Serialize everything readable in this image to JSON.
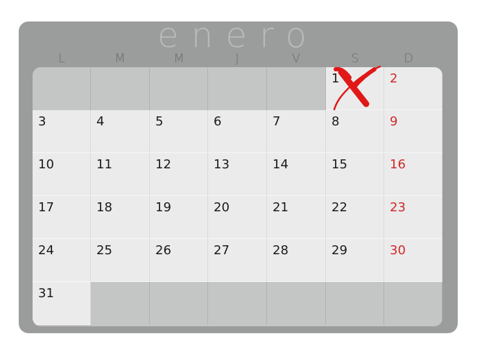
{
  "calendar": {
    "month": "enero",
    "weekdays": [
      "L",
      "M",
      "M",
      "J",
      "V",
      "S",
      "D"
    ],
    "leading_empty_cells": 5,
    "days": [
      "1",
      "2",
      "3",
      "4",
      "5",
      "6",
      "7",
      "8",
      "9",
      "10",
      "11",
      "12",
      "13",
      "14",
      "15",
      "16",
      "17",
      "18",
      "19",
      "20",
      "21",
      "22",
      "23",
      "24",
      "25",
      "26",
      "27",
      "28",
      "29",
      "30",
      "31"
    ],
    "marked_day": "1",
    "colors": {
      "frame": "#9b9d9d",
      "day_cell": "#ebebeb",
      "empty_cell": "#c4c6c6",
      "sunday_text": "#cf2a2a",
      "day_text": "#1a1a1a",
      "cross": "#e01818"
    }
  }
}
